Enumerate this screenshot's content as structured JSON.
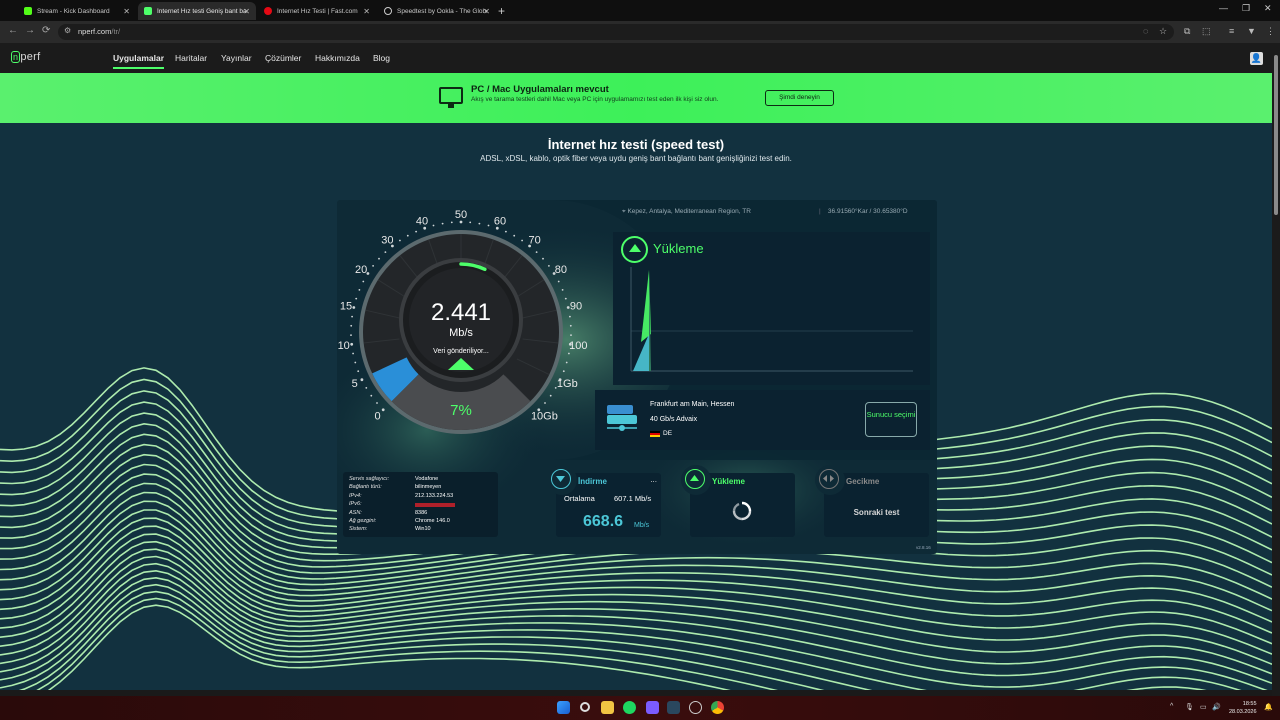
{
  "browser": {
    "tabs": [
      {
        "title": "Stream - Kick Dashboard",
        "favicon_color": "#53fc18",
        "active": false
      },
      {
        "title": "İnternet Hız testi Geniş bant bağ...",
        "favicon_color": "#4dff6a",
        "active": true
      },
      {
        "title": "İnternet Hız Testi | Fast.com",
        "favicon_color": "#e50914",
        "active": false
      },
      {
        "title": "Speedtest by Ookla - The Global...",
        "favicon_color": "#cccccc",
        "active": false
      }
    ],
    "url_host": "nperf.com",
    "url_path": "/tr/"
  },
  "site": {
    "logo_mark": "n",
    "logo_text": "perf",
    "nav": [
      "Uygulamalar",
      "Haritalar",
      "Yayınlar",
      "Çözümler",
      "Hakkımızda",
      "Blog"
    ],
    "active_nav": "Uygulamalar"
  },
  "promo": {
    "title": "PC / Mac Uygulamaları mevcut",
    "subtitle": "Akış ve tarama testleri dahil Mac veya PC için uygulamamızı test eden ilk kişi siz olun.",
    "button": "Şimdi deneyin"
  },
  "hero": {
    "title": "İnternet hız testi (speed test)",
    "subtitle": "ADSL, xDSL, kablo, optik fiber veya uydu geniş bant bağlantı bant genişliğinizi test edin."
  },
  "location": {
    "place": "Kepez, Antalya, Mediterranean Region, TR",
    "coords": "36.91560°Kar / 30.65380°D"
  },
  "gauge": {
    "value": "2.441",
    "unit": "Mb/s",
    "status": "Veri gönderiliyor...",
    "progress_label": "7%",
    "progress_fraction": 0.07,
    "scale_labels": [
      "0",
      "5",
      "10",
      "15",
      "20",
      "30",
      "40",
      "50",
      "60",
      "70",
      "80",
      "90",
      "100",
      "1Gb",
      "10Gb"
    ]
  },
  "upload_graph": {
    "label": "Yükleme"
  },
  "server": {
    "city": "Frankfurt am Main, Hessen",
    "isp": "40 Gb/s Advaix",
    "country": "DE",
    "button": "Sunucu seçimi"
  },
  "connection_info": [
    {
      "key": "Servis sağlayıcı:",
      "value": "Vodafone"
    },
    {
      "key": "Bağlantı türü:",
      "value": "bilinmeyen"
    },
    {
      "key": "IPv4:",
      "value": "212.133.224.53"
    },
    {
      "key": "IPv6:",
      "value": ""
    },
    {
      "key": "ASN:",
      "value": "8386"
    },
    {
      "key": "Ağ gezgini:",
      "value": "Chrome 146.0"
    },
    {
      "key": "Sistem:",
      "value": "Win10"
    }
  ],
  "results": {
    "download": {
      "title": "İndirme",
      "avg_label": "Ortalama",
      "avg_value": "607.1 Mb/s",
      "value": "668.6",
      "unit": "Mb/s",
      "more": "..."
    },
    "upload": {
      "title": "Yükleme"
    },
    "latency": {
      "title": "Gecikme",
      "next": "Sonraki test"
    }
  },
  "version": "v2.8.16",
  "taskbar": {
    "time": "18:55",
    "date": "28.03.2026"
  },
  "colors": {
    "accent_green": "#4dff6a",
    "accent_cyan": "#4cc7d7",
    "background": "#12313f"
  }
}
